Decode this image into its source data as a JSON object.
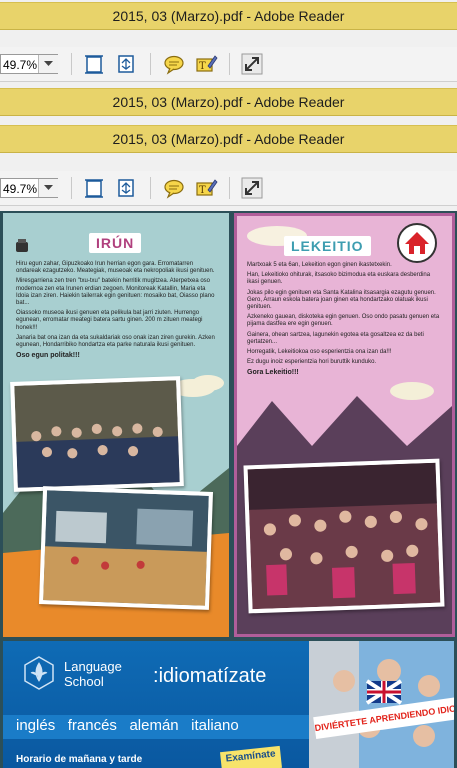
{
  "window": {
    "title_1": "2015, 03 (Marzo).pdf - Adobe Reader",
    "title_2": "2015, 03 (Marzo).pdf - Adobe Reader",
    "title_3": "2015, 03 (Marzo).pdf - Adobe Reader"
  },
  "toolbar": {
    "zoom_value": "49.7%"
  },
  "icons": [
    "fit-page-icon",
    "rotate-icon",
    "comment-icon",
    "sign-icon",
    "expand-icon",
    "chevron-down-icon"
  ],
  "doc": {
    "left": {
      "title": "IRÚN",
      "p1": "Hiru egun zahar, Gipuzkoako Irun herrian egon gara. Erromatarren ondareak ezagutzeko. Meategiak, museoak eta nekropoliak ikusi genituen.",
      "p2": "Miresgarriena zen tren \"txu-txu\" batekin herritik mugitzea. Aterpetxea oso modernoa zen eta Irunen erdian zegoen. Monitoreak Katallin, Maria eta Idoia izan ziren. Haiekin tailerrak egin genituen: mosaiko bat, Oiasso plano bat...",
      "p3": "Oiassoko museoa ikusi genuen eta pelikula bat jarri ziuten. Hurrengo egunean, erromatar meategi batera sartu ginen. 200 m zituen meategi honek!!!",
      "p4": "Janaria bat ona izan da eta sukaldariak oso onak izan ziren gurekin. Azken egunean, Hondarribiko hondartza eta parke naturala ikusi genituen.",
      "p5": "Oso egun politak!!!"
    },
    "right": {
      "title": "LEKEITIO",
      "p1": "Martxoak 5 eta 6an, Lekeition egon ginen ikastetxekin.",
      "p2": "Han, Lekeitioko ohiturak, itsasoko bizimodua eta euskara desberdina ikasi genuen.",
      "p3": "Jokas pilo egin genituen eta Santa Katalina itsasargia ezagutu genuen. Gero, Arraun eskola batera joan ginen eta hondartzako olatuak ikusi genituen.",
      "p4": "Azkeneko gauean, diskoteka egin genuen. Oso ondo pasatu genuen eta pijama dastfea ere egin genuen.",
      "p5": "Gainera, ohean sartzea, lagunekin egotea eta gosaltzea ez da beti gertatzen...",
      "p6": "Horregatik, Lekeitiokoa oso esperientzia ona izan da!!!",
      "p7": "Ez dugu inoiz esperientzia hori buruttik kunduko.",
      "p8": "Gora Lekeitio!!!"
    },
    "banner": {
      "school_1": "Language",
      "school_2": "School",
      "brand_prefix": ":",
      "brand": "idiomatízate",
      "lang_1": "inglés",
      "lang_2": "francés",
      "lang_3": "alemán",
      "lang_4": "italiano",
      "slogan": "DIVIÉRTETE APRENDIENDO IDIOMAS",
      "schedule": "Horario de mañana y tarde",
      "badge": "Examínate"
    }
  },
  "colors": {
    "titlebar": "#e8d36a",
    "left_panel": "#a8cfd0",
    "right_panel": "#e8b4d6",
    "right_border": "#b05e9a",
    "banner": "#0f6bb5",
    "slogan": "#e2231a"
  }
}
